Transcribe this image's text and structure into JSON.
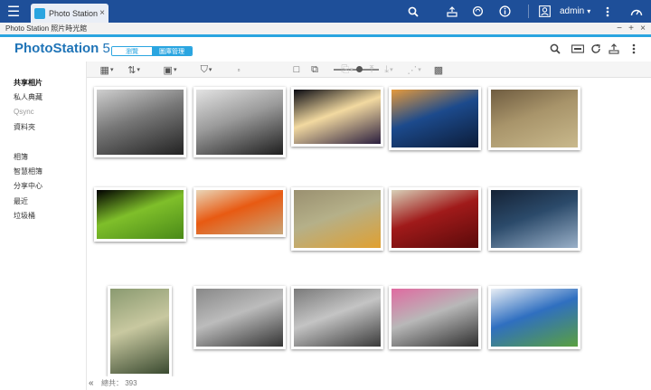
{
  "system_bar": {
    "app_tab_label": "Photo Station ...",
    "tab_close": "×",
    "user_name": "admin",
    "user_caret": "▾"
  },
  "window": {
    "title": "Photo Station 照片時光館",
    "minimize": "−",
    "maximize": "+",
    "close": "×"
  },
  "header": {
    "brand_name": "PhotoStation",
    "brand_version": " 5",
    "browse_label": "瀏覽",
    "manage_label": "圖庫管理"
  },
  "sidebar": {
    "shared_items": [
      {
        "label": "共享相片",
        "active": true
      },
      {
        "label": "私人典藏",
        "active": false
      },
      {
        "label": "Qsync",
        "muted": true
      },
      {
        "label": "資料夾",
        "active": false
      }
    ],
    "album_items": [
      {
        "label": "相簿"
      },
      {
        "label": "智慧相簿"
      },
      {
        "label": "分享中心"
      },
      {
        "label": "最近"
      },
      {
        "label": "垃圾桶"
      }
    ]
  },
  "toolbar": {
    "zoom_level": 0.55
  },
  "photos": [
    {
      "subject": "children-faces-bw",
      "colors": [
        "#777777",
        "#222222",
        "#cfcfcf"
      ]
    },
    {
      "subject": "girl-close-up-bw",
      "colors": [
        "#9a9a9a",
        "#1e1e1e",
        "#e3e3e3"
      ]
    },
    {
      "subject": "night-traffic",
      "colors": [
        "#f2d9a0",
        "#2a1e3e",
        "#0a0a12"
      ]
    },
    {
      "subject": "city-skyline-blue",
      "colors": [
        "#1c4a8c",
        "#0c1c38",
        "#e59a3c"
      ]
    },
    {
      "subject": "monkey",
      "colors": [
        "#a8946a",
        "#c9b98c",
        "#6f5c40"
      ]
    },
    {
      "subject": "insect-on-leaf",
      "colors": [
        "#7fbf2a",
        "#4a8a18",
        "#000000"
      ]
    },
    {
      "subject": "orange-butterfly",
      "colors": [
        "#e85a12",
        "#c9a67a",
        "#e9d6b8"
      ]
    },
    {
      "subject": "caterpillar",
      "colors": [
        "#b5b089",
        "#e0a030",
        "#9a9070"
      ]
    },
    {
      "subject": "moth-on-red",
      "colors": [
        "#a01a1a",
        "#5a0a0a",
        "#d8d0b8"
      ]
    },
    {
      "subject": "skyscrapers-dusk",
      "colors": [
        "#2b4a6a",
        "#9ab0c8",
        "#152235"
      ]
    },
    {
      "subject": "cable-cars",
      "colors": [
        "#c8c8a0",
        "#3a4a30",
        "#8a9a70"
      ]
    },
    {
      "subject": "children-dancing-1",
      "colors": [
        "#bcbcbc",
        "#333333",
        "#888888"
      ]
    },
    {
      "subject": "children-dancing-2",
      "colors": [
        "#c4c4c4",
        "#3a3a3a",
        "#7a7a7a"
      ]
    },
    {
      "subject": "children-dancing-3",
      "colors": [
        "#b8b8b8",
        "#2e2e2e",
        "#e06aa0"
      ]
    },
    {
      "subject": "pier-lagoon",
      "colors": [
        "#2f6fc0",
        "#5aa040",
        "#e8eef5"
      ]
    }
  ],
  "footer": {
    "collapse": "«",
    "total_label": "總共：",
    "total_count": "393"
  },
  "colors": {
    "system_bar": "#1e4f99",
    "accent": "#2aa5e0",
    "brand": "#1f74b7"
  }
}
